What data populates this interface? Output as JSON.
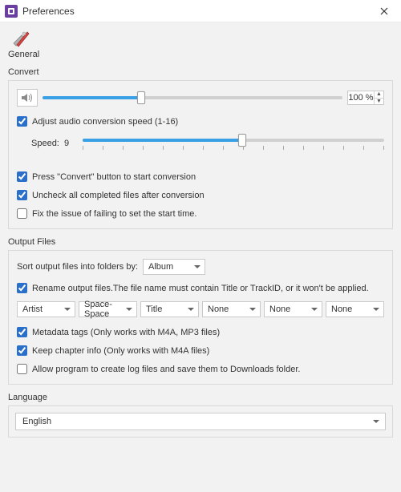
{
  "window": {
    "title": "Preferences"
  },
  "general": {
    "label": "General"
  },
  "convert": {
    "title": "Convert",
    "volume": {
      "percent_label": "100 %",
      "percent_value": 100,
      "fill_pct": 33
    },
    "adjust_speed": {
      "checked": true,
      "label": "Adjust audio conversion speed (1-16)",
      "speed_label": "Speed:",
      "value": 9,
      "min": 1,
      "max": 16,
      "fill_pct": 53
    },
    "press_convert": {
      "checked": true,
      "label": "Press \"Convert\" button to start conversion"
    },
    "uncheck_after": {
      "checked": true,
      "label": "Uncheck all completed files after conversion"
    },
    "fix_start_time": {
      "checked": false,
      "label": "Fix the issue of failing to set the start time."
    }
  },
  "output": {
    "title": "Output Files",
    "sort_label": "Sort output files into folders by:",
    "sort_value": "Album",
    "rename": {
      "checked": true,
      "label": "Rename output files.The file name must contain Title or TrackID, or it won't be applied."
    },
    "name_parts": [
      "Artist",
      "Space-Space",
      "Title",
      "None",
      "None",
      "None"
    ],
    "metadata": {
      "checked": true,
      "label": "Metadata tags (Only works with M4A, MP3 files)"
    },
    "chapter": {
      "checked": true,
      "label": "Keep chapter info (Only works with M4A files)"
    },
    "logs": {
      "checked": false,
      "label": "Allow program to create log files and save them to Downloads folder."
    }
  },
  "language": {
    "title": "Language",
    "value": "English"
  }
}
